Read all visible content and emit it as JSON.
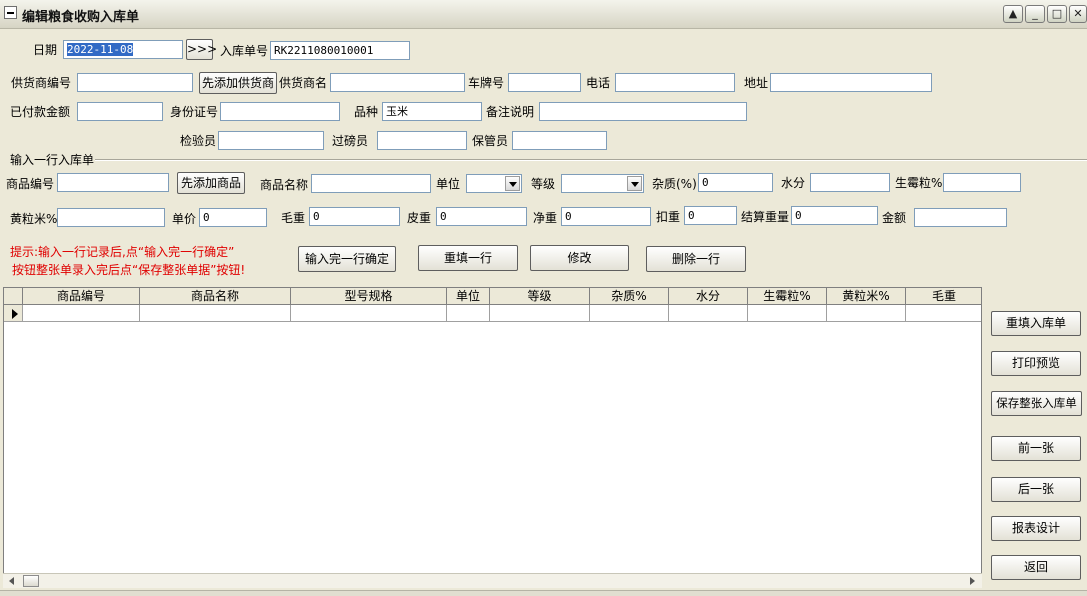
{
  "window": {
    "title": "编辑粮食收购入库单",
    "min_symbol": "_",
    "max_symbol": "□",
    "close_symbol": "✕",
    "up_symbol": "▲"
  },
  "header": {
    "date_label": "日期",
    "date_value": "2022-11-08",
    "date_picker_label": ">>>",
    "receipt_no_label": "入库单号",
    "receipt_no_value": "RK2211080010001",
    "supplier_no_label": "供货商编号",
    "add_supplier_label": "先添加供货商",
    "supplier_name_label": "供货商名",
    "plate_label": "车牌号",
    "phone_label": "电话",
    "address_label": "地址",
    "paid_amount_label": "已付款金额",
    "id_card_label": "身份证号",
    "variety_label": "品种",
    "variety_value": "玉米",
    "remark_label": "备注说明",
    "inspector_label": "检验员",
    "weigher_label": "过磅员",
    "keeper_label": "保管员"
  },
  "line_entry": {
    "group_label": "输入一行入库单",
    "product_no_label": "商品编号",
    "add_product_label": "先添加商品",
    "product_name_label": "商品名称",
    "unit_label": "单位",
    "grade_label": "等级",
    "impurity_label": "杂质(%)",
    "impurity_value": "0",
    "moisture_label": "水分",
    "mildew_label": "生霉粒%",
    "yellow_label": "黄粒米%",
    "price_label": "单价",
    "price_value": "0",
    "gross_label": "毛重",
    "gross_value": "0",
    "tare_label": "皮重",
    "tare_value": "0",
    "net_label": "净重",
    "net_value": "0",
    "deduct_label": "扣重",
    "deduct_value": "0",
    "settle_label": "结算重量",
    "settle_value": "0",
    "amount_label": "金额"
  },
  "hints": {
    "line1": "提示:输入一行记录后,点“输入完一行确定”",
    "line2": "按钮整张单录入完后点“保存整张单据”按钮!"
  },
  "actions": {
    "confirm_row": "输入完一行确定",
    "refill_row": "重填一行",
    "modify": "修改",
    "delete_row": "删除一行"
  },
  "grid": {
    "columns": [
      "商品编号",
      "商品名称",
      "型号规格",
      "单位",
      "等级",
      "杂质%",
      "水分",
      "生霉粒%",
      "黄粒米%",
      "毛重"
    ]
  },
  "side_buttons": {
    "refill_receipt": "重填入库单",
    "print_preview": "打印预览",
    "save_receipt": "保存整张入库单",
    "prev": "前一张",
    "next": "后一张",
    "report_design": "报表设计",
    "back": "返回"
  },
  "icons": {
    "system_menu": "system-menu-icon",
    "row_pointer": "row-pointer-icon",
    "dropdown": "chevron-down-icon"
  },
  "colors": {
    "hint_text": "#e00000",
    "selection": "#316ac5",
    "window_bg": "#ece9d8"
  }
}
